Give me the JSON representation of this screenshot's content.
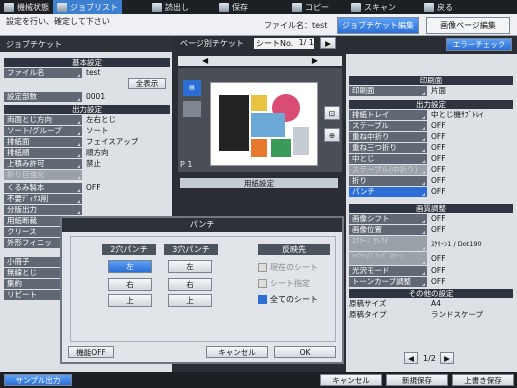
{
  "top_menu": [
    "機械状態",
    "ジョブリスト",
    "読出し",
    "保存",
    "コピー",
    "スキャン",
    "戻る"
  ],
  "prompt": "設定を行い、確定して下さい",
  "file_name_label": "ファイル名：test",
  "tabs": {
    "job_ticket_edit": "ジョブチケット編集",
    "page_image_edit": "画像ページ編集"
  },
  "left": {
    "header": "ジョブチケット",
    "basic": "基本設定",
    "file_name_key": "ファイル名",
    "file_name_val": "test",
    "show_all": "全表示",
    "copies_key": "設定部数",
    "copies_val": "0001",
    "output": "出力設定",
    "rows": [
      {
        "k": "両面とじ方向",
        "v": "左右とじ"
      },
      {
        "k": "ソート/グループ",
        "v": "ソート"
      },
      {
        "k": "排紙面",
        "v": "フェイスアップ"
      },
      {
        "k": "排紙順",
        "v": "順方向"
      },
      {
        "k": "上積み許可",
        "v": "禁止"
      },
      {
        "k": "折り目強化",
        "v": ""
      }
    ],
    "below": [
      {
        "k": "くるみ製本",
        "v": "OFF"
      },
      {
        "k": "不要ﾃﾞｨｸｽ削",
        "v": ""
      },
      {
        "k": "分版出力",
        "v": ""
      },
      {
        "k": "用紙断裁",
        "v": ""
      },
      {
        "k": "クリース",
        "v": ""
      },
      {
        "k": "外形フィニッ",
        "v": ""
      },
      {
        "k": "小冊子",
        "v": ""
      },
      {
        "k": "無線とじ",
        "v": ""
      },
      {
        "k": "集約",
        "v": ""
      },
      {
        "k": "リピート",
        "v": ""
      }
    ]
  },
  "center": {
    "page_ticket": "ページ別チケット",
    "sheet_no": "シートNo.",
    "sheet_val": "1/  1",
    "page_label": "P  1",
    "paper_settings": "用紙設定"
  },
  "right": {
    "error_check": "エラーチェック",
    "print_side": "印刷面",
    "print_side_key": "印刷面",
    "print_side_val": "片面",
    "output": "出力設定",
    "rows": [
      {
        "k": "排紙トレイ",
        "v": "中とじ機ｻﾌﾞﾄﾚｲ"
      },
      {
        "k": "ステープル",
        "v": "OFF"
      },
      {
        "k": "重ね中折り",
        "v": "OFF"
      },
      {
        "k": "重ね三つ折り",
        "v": "OFF"
      },
      {
        "k": "中とじ",
        "v": "OFF"
      },
      {
        "k": "ステープル(中折り)",
        "v": "OFF"
      },
      {
        "k": "折り",
        "v": "OFF"
      },
      {
        "k": "パンチ",
        "v": "OFF"
      }
    ],
    "image": "画質調整",
    "img_rows": [
      {
        "k": "画像シフト",
        "v": "OFF"
      },
      {
        "k": "画像位置",
        "v": "OFF"
      },
      {
        "k": "ｽｸﾘｰﾝ ｾﾚｸﾀ",
        "v": "ｽｸﾘｰﾝ1 / Dot190"
      },
      {
        "k": "ﾊｲﾗｲﾄ/ﾌﾞﾗｯｸﾞ ｽｸﾘｰﾝ",
        "v": "OFF"
      },
      {
        "k": "光沢モード",
        "v": "OFF"
      },
      {
        "k": "トーンカーブ調整",
        "v": "OFF"
      }
    ],
    "other": "その他の設定",
    "orig_size_k": "原稿サイズ",
    "orig_size_v": "A4",
    "orig_type_k": "原稿タイプ",
    "orig_type_v": "ランドスケープ",
    "page": "1/2"
  },
  "dialog": {
    "title": "パンチ",
    "col2": "2穴パンチ",
    "col3": "3穴パンチ",
    "left": "左",
    "right": "右",
    "top": "上",
    "apply": "反映先",
    "opt1": "現在のシート",
    "opt2": "シート指定",
    "opt3": "全てのシート",
    "off": "機能OFF",
    "cancel": "キャンセル",
    "ok": "OK"
  },
  "bottom": {
    "sample": "サンプル出力",
    "cancel": "キャンセル",
    "save_new": "新規保存",
    "overwrite": "上書き保存"
  }
}
